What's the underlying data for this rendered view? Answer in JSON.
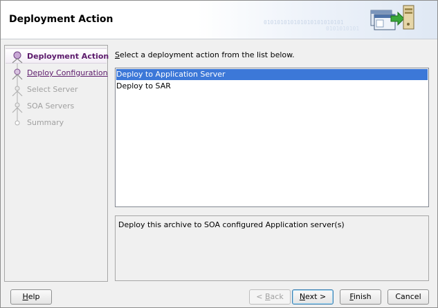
{
  "header": {
    "title": "Deployment Action",
    "decoration": "010101010101010101010101",
    "decoration2": "0101010101"
  },
  "nav": {
    "items": [
      {
        "label": "Deployment Action",
        "state": "active",
        "icon": "current-step-icon"
      },
      {
        "label": "Deploy Configuration",
        "state": "link",
        "icon": "step-node-icon"
      },
      {
        "label": "Select Server",
        "state": "disabled",
        "icon": "step-node-icon"
      },
      {
        "label": "SOA Servers",
        "state": "disabled",
        "icon": "step-node-icon"
      },
      {
        "label": "Summary",
        "state": "disabled",
        "icon": "step-end-icon"
      }
    ]
  },
  "main": {
    "instruction_mnemonic": "S",
    "instruction_rest": "elect a deployment action from the list below.",
    "actions": [
      {
        "label": "Deploy to Application Server",
        "selected": true
      },
      {
        "label": "Deploy to SAR",
        "selected": false
      }
    ],
    "description": "Deploy this archive to SOA configured Application server(s)"
  },
  "buttons": {
    "help": {
      "mnemonic": "H",
      "rest": "elp"
    },
    "back": {
      "prefix": "< ",
      "mnemonic": "B",
      "rest": "ack"
    },
    "next": {
      "mnemonic": "N",
      "rest": "ext >"
    },
    "finish": {
      "mnemonic": "F",
      "rest": "inish"
    },
    "cancel": "Cancel"
  },
  "colors": {
    "accent_purple": "#5c1a6b",
    "selection_blue": "#3c78d8",
    "disabled_gray": "#a0a0a0"
  }
}
